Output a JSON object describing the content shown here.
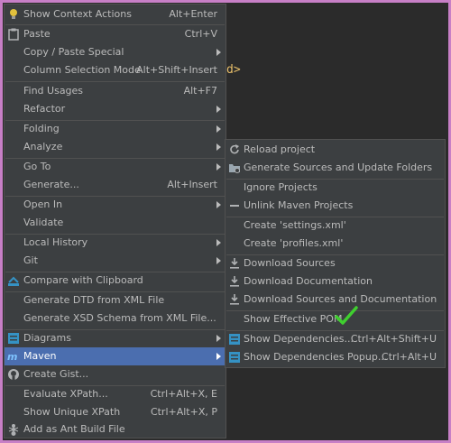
{
  "editor": {
    "tag_fragment": "d>"
  },
  "main_menu": {
    "items": [
      {
        "label": "Show Context Actions",
        "shortcut": "Alt+Enter",
        "icon": "lightbulb-icon"
      },
      {
        "label": "Paste",
        "shortcut": "Ctrl+V",
        "icon": "clipboard-icon"
      },
      {
        "label": "Copy / Paste Special",
        "submenu": true
      },
      {
        "label": "Column Selection Mode",
        "shortcut": "Alt+Shift+Insert"
      },
      {
        "label": "Find Usages",
        "shortcut": "Alt+F7"
      },
      {
        "label": "Refactor",
        "submenu": true
      },
      {
        "label": "Folding",
        "submenu": true
      },
      {
        "label": "Analyze",
        "submenu": true
      },
      {
        "label": "Go To",
        "submenu": true
      },
      {
        "label": "Generate...",
        "shortcut": "Alt+Insert"
      },
      {
        "label": "Open In",
        "submenu": true
      },
      {
        "label": "Validate"
      },
      {
        "label": "Local History",
        "submenu": true
      },
      {
        "label": "Git",
        "submenu": true
      },
      {
        "label": "Compare with Clipboard",
        "icon": "compare-icon"
      },
      {
        "label": "Generate DTD from XML File"
      },
      {
        "label": "Generate XSD Schema from XML File..."
      },
      {
        "label": "Diagrams",
        "submenu": true,
        "icon": "diagram-icon"
      },
      {
        "label": "Maven",
        "submenu": true,
        "icon": "maven-icon",
        "selected": true
      },
      {
        "label": "Create Gist...",
        "icon": "github-icon"
      },
      {
        "label": "Evaluate XPath...",
        "shortcut": "Ctrl+Alt+X, E"
      },
      {
        "label": "Show Unique XPath",
        "shortcut": "Ctrl+Alt+X, P"
      },
      {
        "label": "Add as Ant Build File",
        "icon": "ant-icon"
      }
    ]
  },
  "maven_menu": {
    "items": [
      {
        "label": "Reload project",
        "icon": "reload-icon"
      },
      {
        "label": "Generate Sources and Update Folders",
        "icon": "generate-folders-icon"
      },
      {
        "label": "Ignore Projects"
      },
      {
        "label": "Unlink Maven Projects",
        "icon": "minus-icon"
      },
      {
        "label": "Create 'settings.xml'"
      },
      {
        "label": "Create 'profiles.xml'"
      },
      {
        "label": "Download Sources",
        "icon": "download-icon"
      },
      {
        "label": "Download Documentation",
        "icon": "download-icon"
      },
      {
        "label": "Download Sources and Documentation",
        "icon": "download-icon"
      },
      {
        "label": "Show Effective POM"
      },
      {
        "label": "Show Dependencies...",
        "shortcut": "Ctrl+Alt+Shift+U",
        "icon": "dependencies-icon"
      },
      {
        "label": "Show Dependencies Popup...",
        "shortcut": "Ctrl+Alt+U",
        "icon": "dependencies-icon"
      }
    ]
  },
  "colors": {
    "frame": "#c77fc6",
    "menu_bg": "#3c3f41",
    "selected_bg": "#4b6eaf",
    "text": "#bbbbbb",
    "check": "#3fcf2f"
  }
}
